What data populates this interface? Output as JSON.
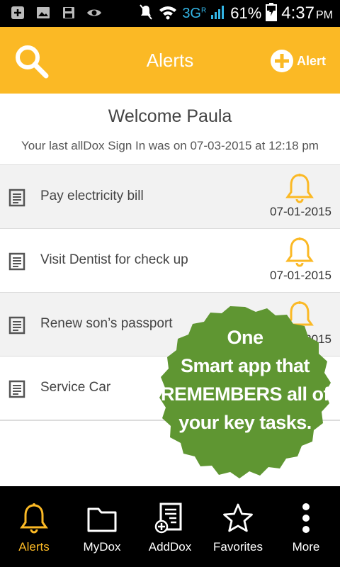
{
  "status_bar": {
    "network": "3G",
    "roaming": "R",
    "battery_pct": "61%",
    "time": "4:37",
    "ampm": "PM"
  },
  "app_bar": {
    "title": "Alerts",
    "add_alert_label": "Alert",
    "background_color": "#fbb925"
  },
  "welcome": {
    "title": "Welcome Paula",
    "subtitle": "Your last allDox Sign In was on 07-03-2015 at 12:18 pm"
  },
  "alerts": [
    {
      "label": "Pay electricity bill",
      "date": "07-01-2015"
    },
    {
      "label": "Visit Dentist for check up",
      "date": "07-01-2015"
    },
    {
      "label": "Renew son’s passport",
      "date": "07-01-2015"
    },
    {
      "label": "Service Car",
      "date": ""
    }
  ],
  "promo": {
    "lines": [
      "One",
      "Smart app that",
      "REMEMBERS all of",
      "your key tasks."
    ],
    "color": "#5f9632"
  },
  "bottom_nav": [
    {
      "label": "Alerts",
      "icon": "bell-icon",
      "active": true
    },
    {
      "label": "MyDox",
      "icon": "folder-icon",
      "active": false
    },
    {
      "label": "AddDox",
      "icon": "add-document-icon",
      "active": false
    },
    {
      "label": "Favorites",
      "icon": "star-icon",
      "active": false
    },
    {
      "label": "More",
      "icon": "more-vertical-icon",
      "active": false
    }
  ]
}
